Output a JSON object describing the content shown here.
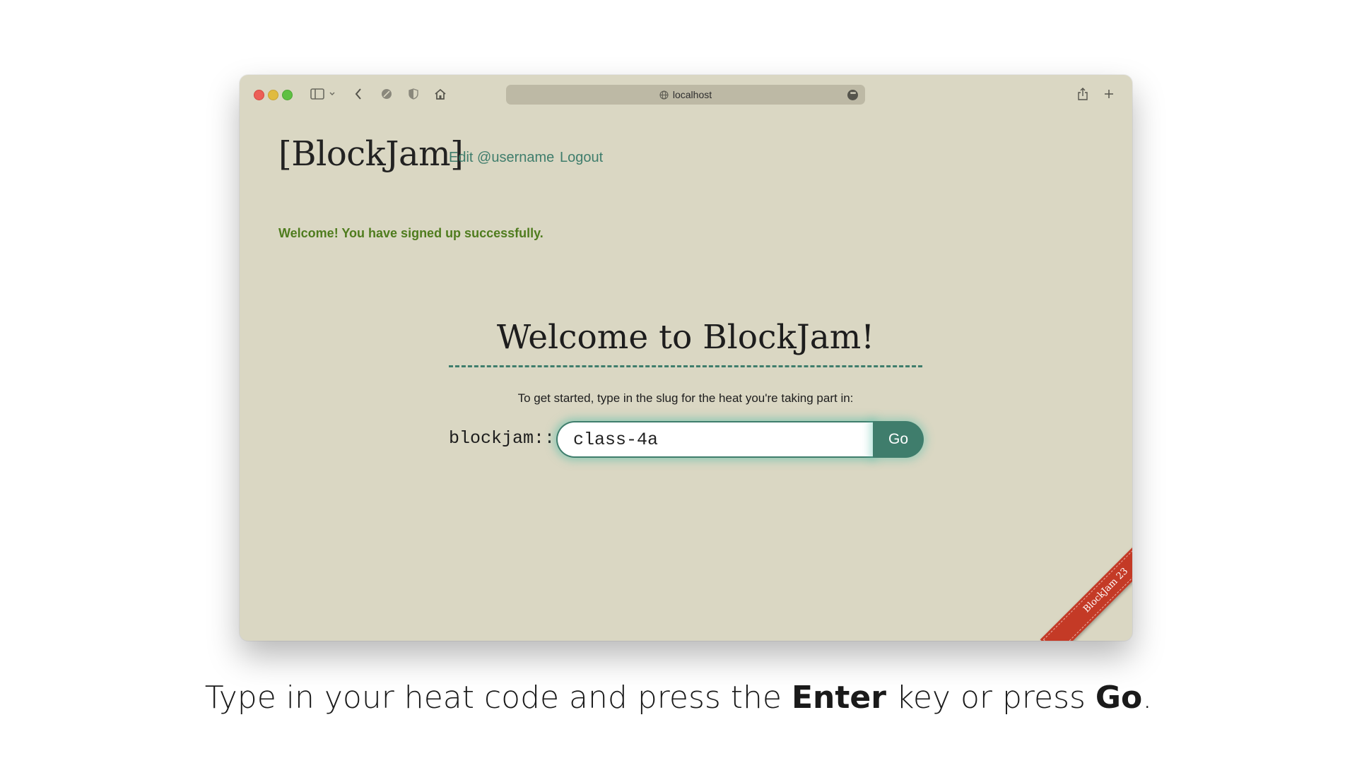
{
  "browser": {
    "url": "localhost",
    "icons": [
      "sidebar-icon",
      "chevron-down-icon",
      "back-icon",
      "privacy-icon",
      "shield-icon",
      "home-icon",
      "globe-icon",
      "more-icon",
      "share-icon",
      "new-tab-icon"
    ]
  },
  "header": {
    "brand": "[BlockJam]",
    "edit_link": "Edit @username",
    "logout_link": "Logout"
  },
  "flash": "Welcome! You have signed up successfully.",
  "main": {
    "heading": "Welcome to BlockJam!",
    "instructions": "To get started, type in the slug for the heat you're taking part in:",
    "prefix": "blockjam::",
    "slug_value": "class-4a",
    "go_label": "Go"
  },
  "ribbon": "BlockJam 23",
  "caption": {
    "part1": "Type in your heat code and press the ",
    "bold1": "Enter",
    "part2": " key or press ",
    "bold2": "Go",
    "part3": "."
  },
  "colors": {
    "page_bg": "#dad7c3",
    "accent": "#3f7d6c",
    "flash_text": "#4f7c1e",
    "ribbon": "#c43a26"
  }
}
